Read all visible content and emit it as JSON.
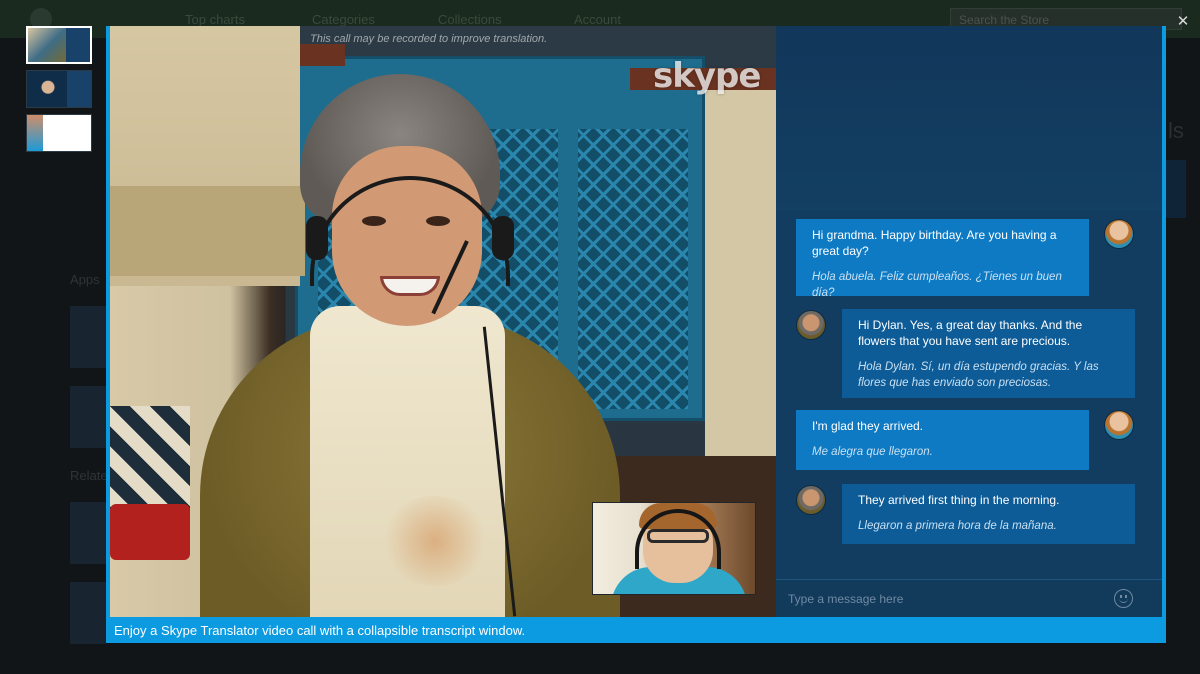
{
  "background_page": {
    "nav": [
      "Top charts",
      "Categories",
      "Collections",
      "Account"
    ],
    "search_placeholder": "Search the Store",
    "section_apps": "Apps",
    "section_related": "Related"
  },
  "thumbnails": [
    {
      "label": "Screenshot 1",
      "active": true
    },
    {
      "label": "Screenshot 2",
      "active": false
    },
    {
      "label": "Screenshot 3",
      "active": false
    }
  ],
  "video": {
    "record_note": "This call may be recorded to improve translation.",
    "watermark": "skype"
  },
  "transcript": {
    "messages": [
      {
        "from": "Dylan",
        "direction": "sent",
        "original": "Hi grandma. Happy birthday. Are you having a great day?",
        "translation": "Hola abuela. Feliz cumpleaños. ¿Tienes un buen día?"
      },
      {
        "from": "Grandma",
        "direction": "received",
        "original": "Hi Dylan. Yes, a great day thanks. And the flowers that you have sent are precious.",
        "translation": "Hola Dylan. Sí, un día estupendo gracias. Y las flores que has enviado son preciosas."
      },
      {
        "from": "Dylan",
        "direction": "sent",
        "original": "I'm glad they arrived.",
        "translation": "Me alegra que llegaron."
      },
      {
        "from": "Grandma",
        "direction": "received",
        "original": "They arrived first thing in the morning.",
        "translation": "Llegaron a primera hora de la mañana."
      }
    ],
    "input_placeholder": "Type a message here"
  },
  "caption": "Enjoy a Skype Translator video call with a collapsible transcript window.",
  "icons": {
    "close": "close-icon",
    "emoji": "emoji-icon",
    "more": "more-options-icon"
  },
  "colors": {
    "frame_blue": "#0c9ae0",
    "panel_navy": "#123d60",
    "bubble_sent": "#0e7ac3",
    "bubble_received": "#0d5b97"
  }
}
